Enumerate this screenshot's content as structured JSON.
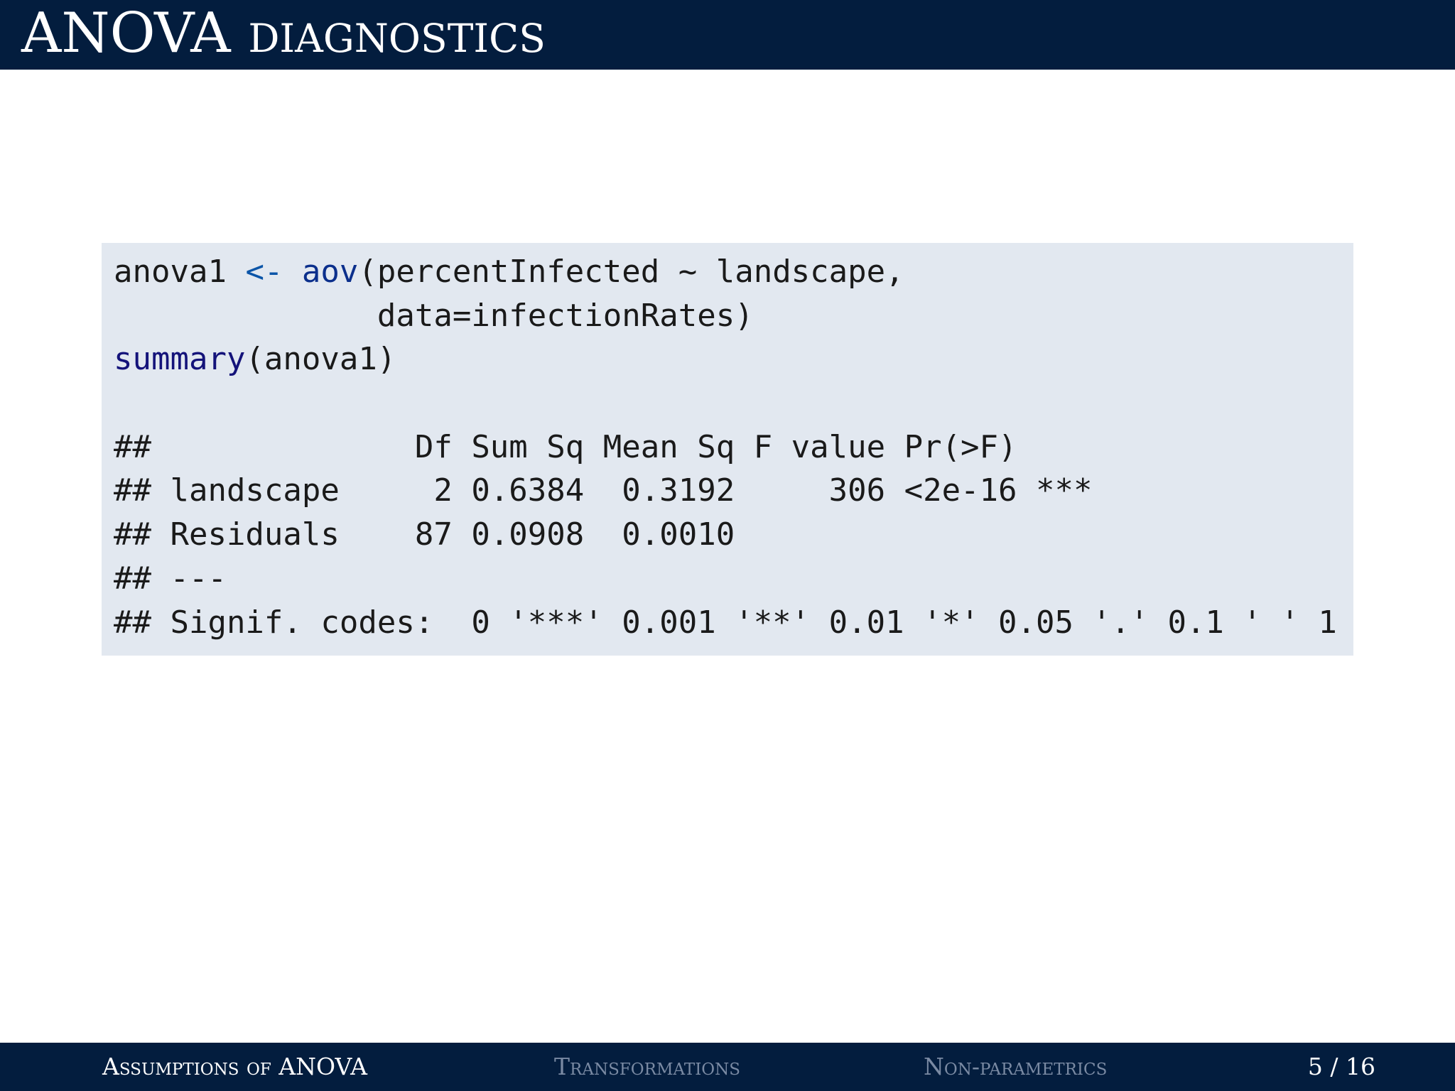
{
  "slide": {
    "title_main": "ANOVA",
    "title_sub": "diagnostics"
  },
  "code": {
    "line1_prefix": "anova1 ",
    "line1_op": "<-",
    "line1_space": " ",
    "line1_fn": "aov",
    "line1_rest": "(percentInfected ~ landscape,",
    "line2": "              data=infectionRates)",
    "line3_fn": "summary",
    "line3_rest": "(anova1)",
    "line4": "",
    "output": [
      "##              Df Sum Sq Mean Sq F value Pr(>F)    ",
      "## landscape     2 0.6384  0.3192     306 <2e-16 ***",
      "## Residuals    87 0.0908  0.0010                   ",
      "## ---",
      "## Signif. codes:  0 '***' 0.001 '**' 0.01 '*' 0.05 '.' 0.1 ' ' 1"
    ]
  },
  "footer": {
    "sections": [
      {
        "label": "Assumptions of ANOVA",
        "active": true
      },
      {
        "label": "Transformations",
        "active": false
      },
      {
        "label": "Non-parametrics",
        "active": false
      }
    ],
    "page": "5 / 16"
  },
  "colors": {
    "bar": "#031d3e",
    "code_bg": "#e2e8f0"
  }
}
